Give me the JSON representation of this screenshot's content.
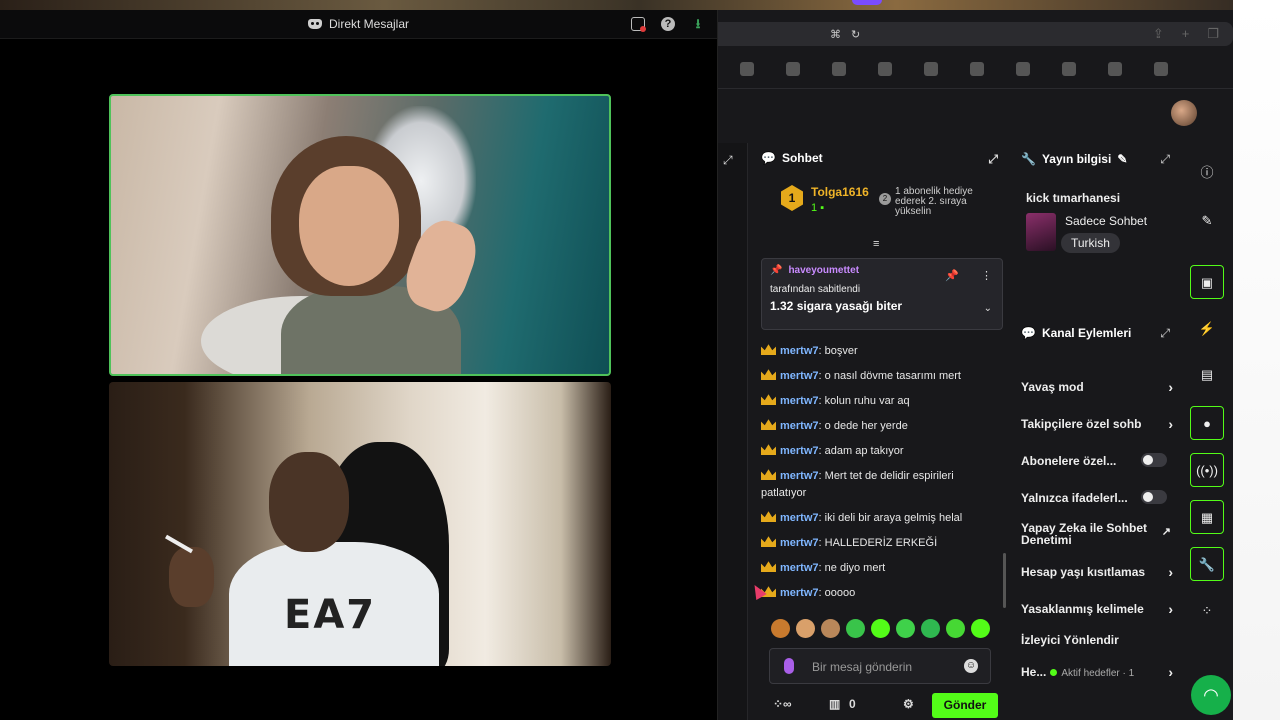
{
  "discord": {
    "title": "Direkt Mesajlar",
    "icons": [
      "monitor-icon",
      "help-icon",
      "download-icon"
    ]
  },
  "chat": {
    "title": "Sohbet",
    "leader": {
      "rank": "1",
      "name": "Tolga1616",
      "subs": "1"
    },
    "leader_info": {
      "rank": "2",
      "text": "1 abonelik hediye ederek 2. sıraya yükselin"
    },
    "pinned": {
      "user": "haveyoumettet",
      "by": "tarafından sabitlendi",
      "message": "1.32 sigara yasağı biter"
    },
    "messages": [
      {
        "user": "mertw7",
        "text": "boşver"
      },
      {
        "user": "mertw7",
        "text": "o nasıl dövme tasarımı mert"
      },
      {
        "user": "mertw7",
        "text": "kolun ruhu var aq"
      },
      {
        "user": "mertw7",
        "text": "o dede her yerde"
      },
      {
        "user": "mertw7",
        "text": "adam ap takıyor"
      },
      {
        "user": "mertw7",
        "text": "Mert tet de delidir espirileri patlatıyor"
      },
      {
        "user": "mertw7",
        "text": "iki deli bir araya gelmiş helal"
      },
      {
        "user": "mertw7",
        "text": "HALLEDERİZ ERKEĞİ"
      },
      {
        "user": "mertw7",
        "text": "ne diyo mert"
      },
      {
        "user": "mertw7",
        "text": "ooooo"
      }
    ],
    "input_placeholder": "Bir mesaj gönderin",
    "points": "0",
    "send_label": "Gönder"
  },
  "stream_info": {
    "title": "Yayın bilgisi",
    "stream_title": "kick tımarhanesi",
    "category": "Sadece Sohbet",
    "tag": "Turkish"
  },
  "channel_actions": {
    "title": "Kanal Eylemleri",
    "slow_mode": "Yavaş mod",
    "followers_only": "Takipçilere özel sohb",
    "subs_only": "Abonelere özel...",
    "emotes_only": "Yalnızca ifadelerl...",
    "ai_moderation": "Yapay Zeka ile Sohbet Denetimi",
    "account_age": "Hesap yaşı kısıtlamas",
    "banned_words": "Yasaklanmış kelimele",
    "redirect": "İzleyici Yönlendir",
    "goals": "He...",
    "goals_sub": "Aktif hedefler · 1"
  },
  "colors": {
    "kick_green": "#53fc18",
    "discord_green": "#4fc25a",
    "crown": "#e5a91b",
    "username": "#7fb6ff"
  }
}
